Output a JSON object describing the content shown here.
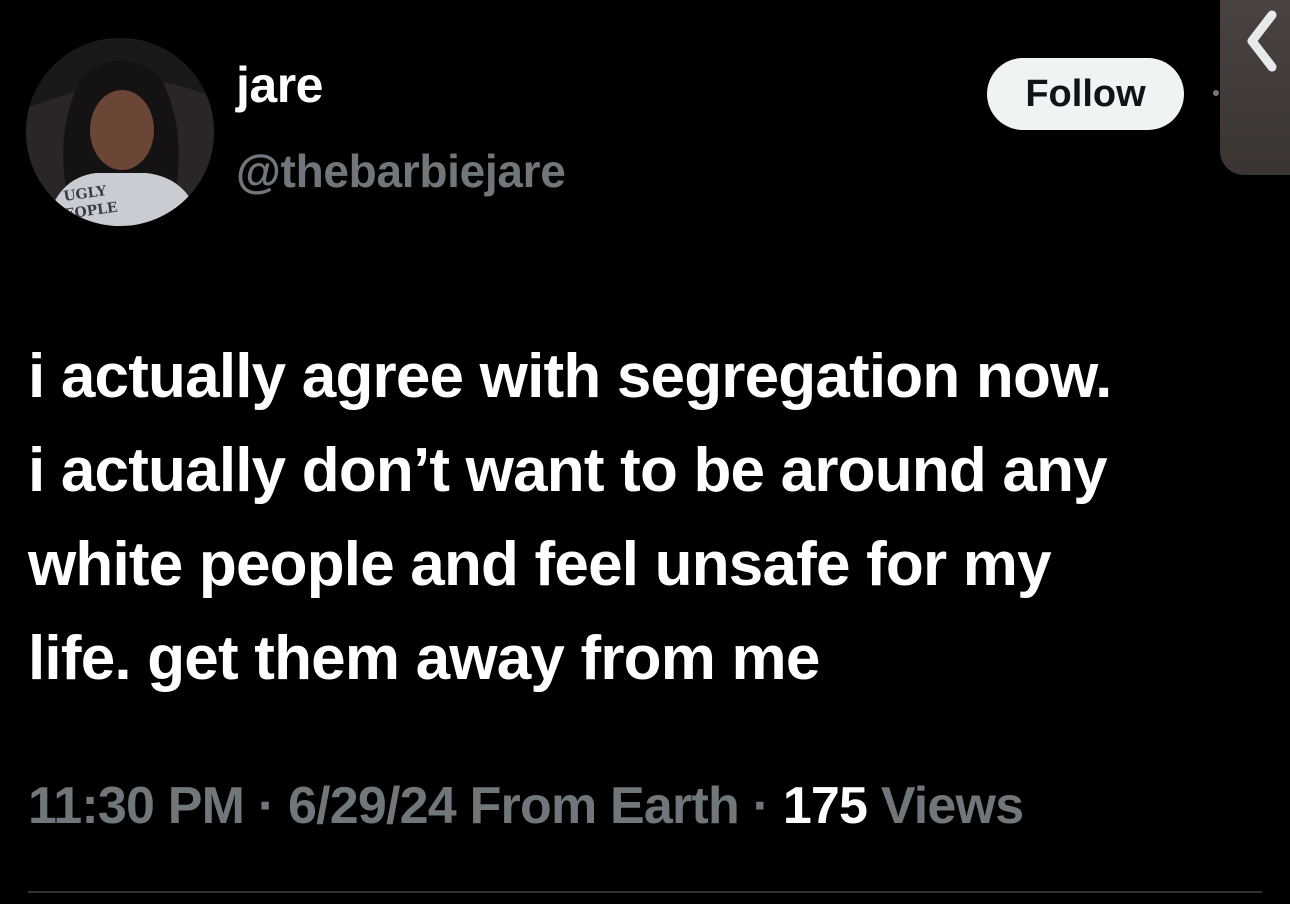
{
  "author": {
    "display_name": "jare",
    "handle": "@thebarbiejare",
    "avatar_shirt_text": "UGLY PEOPLE"
  },
  "actions": {
    "follow_label": "Follow"
  },
  "tweet": {
    "text": "i actually agree with segregation now.\ni actually don’t want to be around any\nwhite people and feel unsafe for my\nlife. get them away from me"
  },
  "meta": {
    "time": "11:30 PM",
    "separator": "·",
    "date": "6/29/24",
    "location": "From Earth",
    "views_count": "175",
    "views_label": "Views"
  },
  "colors": {
    "background": "#000000",
    "primary_text": "#ffffff",
    "secondary_text": "#71767b",
    "follow_bg": "#eff3f4",
    "divider": "#2f3336"
  },
  "icons": {
    "back": "chevron-left-icon",
    "more": "dot-icon"
  }
}
